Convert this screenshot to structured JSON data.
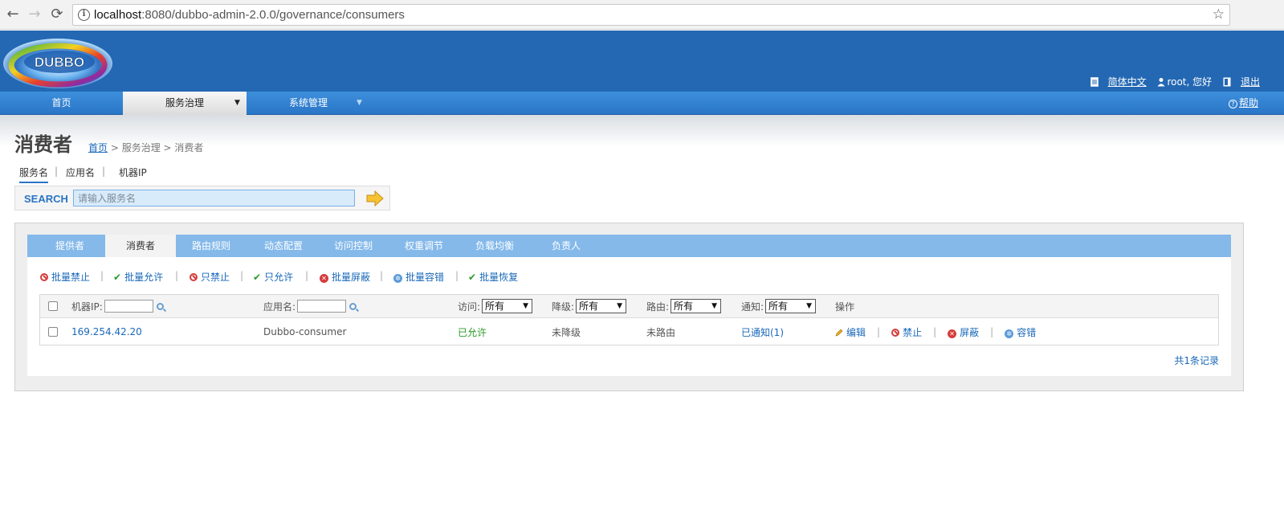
{
  "browser": {
    "url_host": "localhost",
    "url_rest": ":8080/dubbo-admin-2.0.0/governance/consumers",
    "back_glyph": "←",
    "forward_glyph": "→",
    "reload_glyph": "⟳",
    "star_glyph": "☆",
    "info_glyph": "i"
  },
  "header": {
    "logo_text": "DUBBO",
    "lang_link": "简体中文",
    "user_text": "root, 您好",
    "logout_link": "退出"
  },
  "mainnav": {
    "items": [
      {
        "label": "首页"
      },
      {
        "label": "服务治理",
        "caret": "▼"
      },
      {
        "label": "系统管理",
        "caret": "▼"
      }
    ],
    "help_label": "帮助",
    "help_glyph": "?"
  },
  "page": {
    "title": "消费者",
    "breadcrumb_home": "首页",
    "breadcrumb_rest": " > 服务治理 > 消费者"
  },
  "search": {
    "tabs": [
      "服务名",
      "应用名",
      "机器IP"
    ],
    "sep": "|",
    "label": "SEARCH",
    "placeholder": "请输入服务名"
  },
  "panel": {
    "tabs": [
      "提供者",
      "消费者",
      "路由规则",
      "动态配置",
      "访问控制",
      "权重调节",
      "负载均衡",
      "负责人"
    ],
    "ops": [
      "批量禁止",
      "批量允许",
      "只禁止",
      "只允许",
      "批量屏蔽",
      "批量容错",
      "批量恢复"
    ],
    "check_glyph": "✔",
    "x_glyph": "✕",
    "gear_glyph": "✲",
    "columns": {
      "ip": "机器IP:",
      "app": "应用名:",
      "access": "访问:",
      "degrade": "降级:",
      "route": "路由:",
      "notify": "通知:",
      "actions": "操作",
      "select_value": "所有",
      "select_arrow": "▼"
    },
    "rows": [
      {
        "ip": "169.254.42.20",
        "app": "Dubbo-consumer",
        "access": "已允许",
        "degrade": "未降级",
        "route": "未路由",
        "notify": "已通知(1)",
        "actions": [
          "编辑",
          "禁止",
          "屏蔽",
          "容错"
        ]
      }
    ],
    "records": "共1条记录"
  },
  "colors": {
    "header_blue": "#2468b3",
    "nav_blue": "#3d8fdc",
    "tab_blue": "#84b9ea",
    "link_blue": "#1a68b9",
    "allowed_green": "#2a9a2a",
    "danger_red": "#d43c3c"
  }
}
